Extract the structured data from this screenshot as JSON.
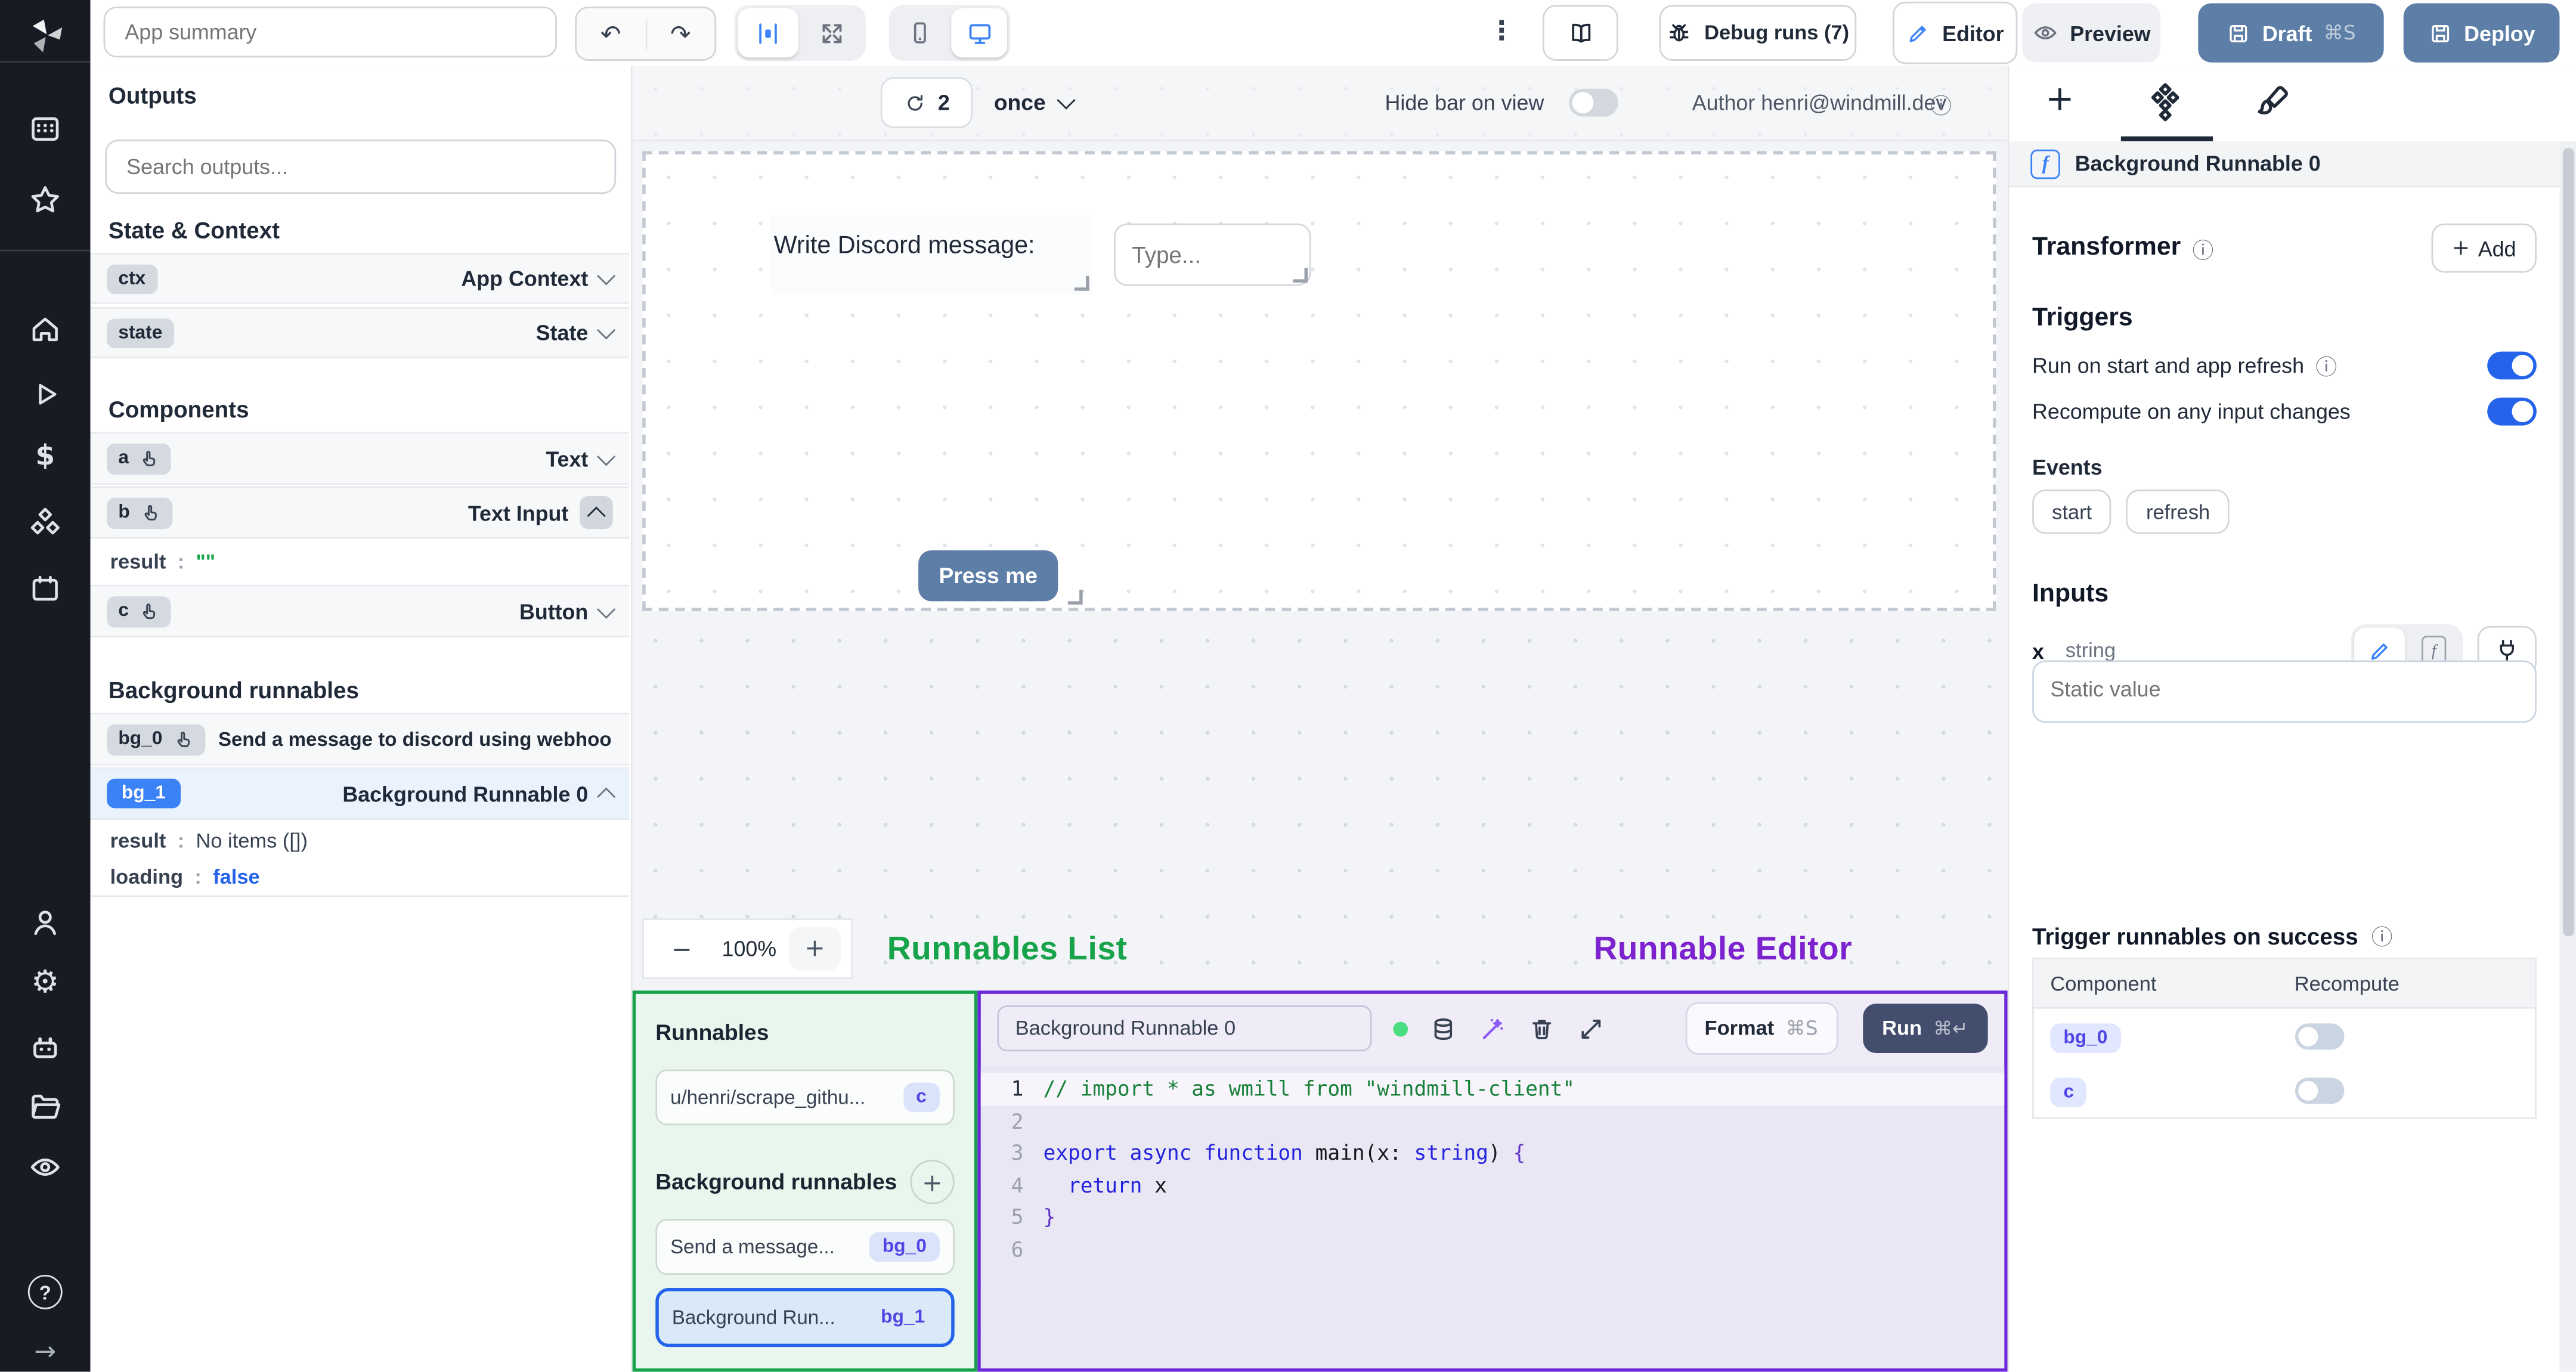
{
  "glyphs": {
    "info": "ⓘ",
    "kebab": "⋮",
    "undo": "↶",
    "redo": "↷",
    "plus": "+",
    "minus": "−",
    "arrow_right": "→",
    "question": "?",
    "dollar": "$",
    "gear": "⚙"
  },
  "colors": {
    "accent": "#3b82f6",
    "toggle_on": "#2563eb",
    "slate_button": "#5d7ea6",
    "run_button": "#434d6e",
    "green": "#16a34a",
    "purple": "#7c22ce",
    "panel_purple_border": "#6d28d9"
  },
  "topbar": {
    "app_summary": "App summary",
    "debug_runs": "Debug runs (7)",
    "editor": "Editor",
    "preview": "Preview",
    "draft": "Draft",
    "draft_kbd": "⌘S",
    "deploy": "Deploy"
  },
  "canvas_toolbar": {
    "refresh_count": "2",
    "schedule": "once",
    "hide_bar_label": "Hide bar on view",
    "author": "Author henri@windmill.dev"
  },
  "canvas": {
    "text_component": "Write Discord message:",
    "input_placeholder": "Type...",
    "button_label": "Press me",
    "zoom_value": "100%",
    "runnables_overlay": "Runnables List",
    "editor_overlay": "Runnable Editor"
  },
  "outputs": {
    "title": "Outputs",
    "search_placeholder": "Search outputs...",
    "state_title": "State & Context",
    "rows": {
      "ctx_id": "ctx",
      "ctx_label": "App Context",
      "state_id": "state",
      "state_label": "State"
    },
    "components_title": "Components",
    "comp": {
      "a_id": "a",
      "a_label": "Text",
      "b_id": "b",
      "b_label": "Text Input",
      "b_result_key": "result",
      "colon": ":",
      "b_result_val": "\"\"",
      "c_id": "c",
      "c_label": "Button"
    },
    "bg_title": "Background runnables",
    "bg": {
      "bg0_id": "bg_0",
      "bg0_label": "Send a message to discord using webhoo",
      "bg1_id": "bg_1",
      "bg1_label": "Background Runnable 0",
      "result_key": "result",
      "result_val": "No items ([])",
      "loading_key": "loading",
      "loading_val": "false"
    }
  },
  "runnables_panel": {
    "title": "Runnables",
    "item1_name": "u/henri/scrape_githu...",
    "item1_badge": "c",
    "bg_title": "Background runnables",
    "plus": "+",
    "item2_name": "Send a message...",
    "item2_badge": "bg_0",
    "item3_name": "Background Run...",
    "item3_badge": "bg_1"
  },
  "editor_panel": {
    "name_value": "Background Runnable 0",
    "format_label": "Format",
    "format_kbd": "⌘S",
    "run_label": "Run",
    "run_kbd": "⌘↵",
    "line_numbers": [
      "1",
      "2",
      "3",
      "4",
      "5",
      "6"
    ],
    "code": {
      "l1": "// import * as wmill from \"windmill-client\"",
      "l3_kw": "export async function",
      "l3_mid": " main(x: ",
      "l3_type": "string",
      "l3_end": ") ",
      "l3_brace": "{",
      "l4_kw": "return",
      "l4_rest": " x",
      "l5_brace": "}"
    }
  },
  "right_panel": {
    "header": "Background Runnable 0",
    "transformer_title": "Transformer",
    "add_label": "Add",
    "triggers_title": "Triggers",
    "trigger_row1": "Run on start and app refresh",
    "trigger_row2": "Recompute on any input changes",
    "events_label": "Events",
    "chip_start": "start",
    "chip_refresh": "refresh",
    "inputs_title": "Inputs",
    "input_name": "x",
    "input_type": "string",
    "static_placeholder": "Static value",
    "success_title": "Trigger runnables on success",
    "col_component": "Component",
    "col_recompute": "Recompute",
    "row1_badge": "bg_0",
    "row2_badge": "c"
  }
}
